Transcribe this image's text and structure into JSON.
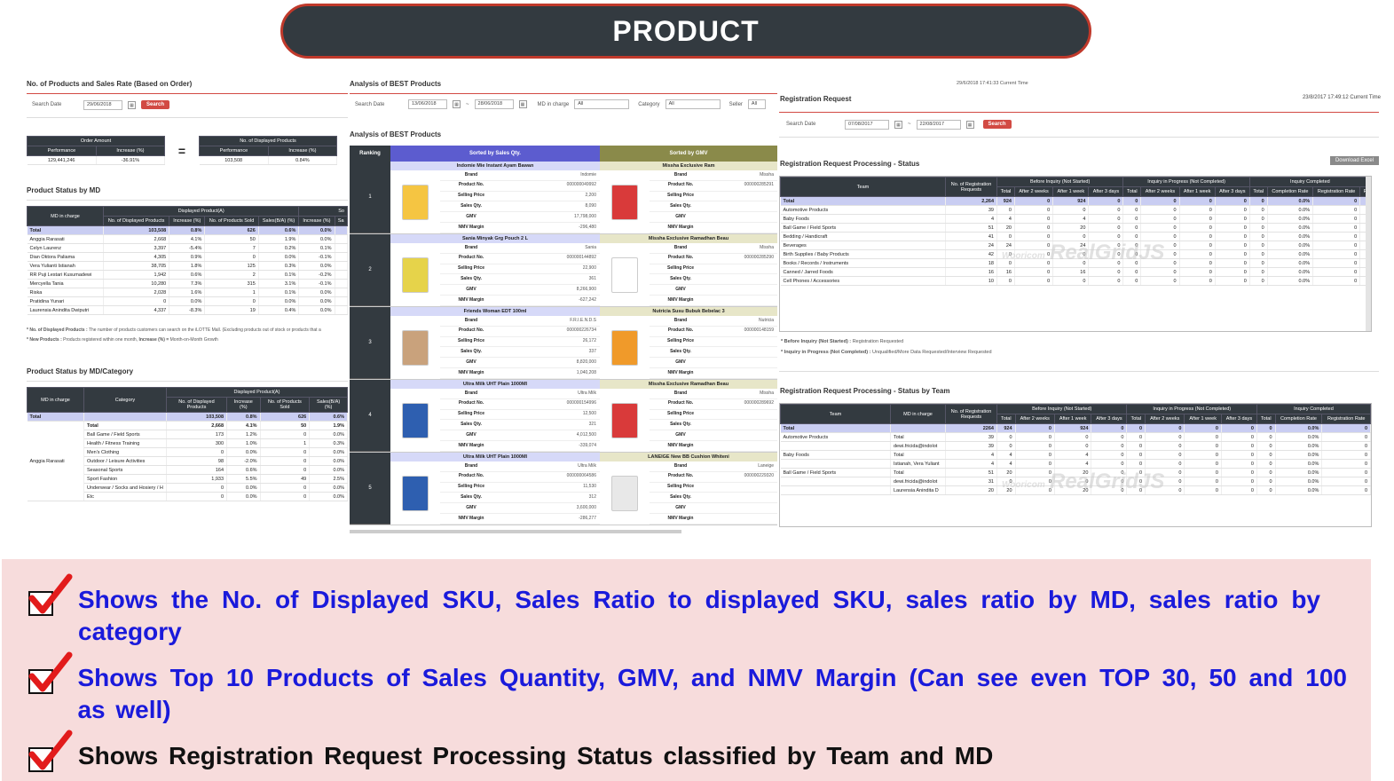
{
  "header": {
    "title": "PRODUCT"
  },
  "panel1": {
    "title": "No. of Products and Sales Rate (Based on Order)",
    "search_label": "Search Date",
    "search_date": "29/06/2018",
    "search_btn": "Search",
    "order_amount": {
      "header": "Order Amount",
      "cols": [
        "Performance",
        "Increase (%)"
      ],
      "values": [
        "129,441,246",
        "-36.91%"
      ]
    },
    "equals": "=",
    "displayed": {
      "header": "No. of Displayed Products",
      "cols": [
        "Performance",
        "Increase (%)"
      ],
      "values": [
        "103,508",
        "0.84%"
      ]
    },
    "md_title": "Product Status by MD",
    "md_group": "Displayed Product(A)",
    "md_group2": "So",
    "md_cols": [
      "MD in charge",
      "No. of Displayed Products",
      "Increase (%)",
      "No. of Products Sold",
      "Sales(B/A) (%)",
      "Increase (%)",
      "Sa"
    ],
    "md_rows": [
      [
        "Total",
        "103,508",
        "0.8%",
        "626",
        "0.6%",
        "0.0%",
        ""
      ],
      [
        "Anggia Rarasati",
        "2,668",
        "4.1%",
        "50",
        "1.9%",
        "0.0%",
        ""
      ],
      [
        "Celyn Laurenz",
        "3,397",
        "-5.4%",
        "7",
        "0.2%",
        "0.1%",
        ""
      ],
      [
        "Dian Oktora Paliama",
        "4,305",
        "0.9%",
        "0",
        "0.0%",
        "-0.1%",
        ""
      ],
      [
        "Vera Yulianti Istianah",
        "38,705",
        "1.8%",
        "125",
        "0.3%",
        "0.0%",
        ""
      ],
      [
        "RR Puji Lestari Kusumadewi",
        "1,942",
        "0.6%",
        "2",
        "0.1%",
        "-0.2%",
        ""
      ],
      [
        "Mercyella Tania",
        "10,280",
        "7.3%",
        "315",
        "3.1%",
        "-0.1%",
        ""
      ],
      [
        "Riska",
        "2,028",
        "1.6%",
        "1",
        "0.1%",
        "0.0%",
        ""
      ],
      [
        "Pratidina Yunari",
        "0",
        "0.0%",
        "0",
        "0.0%",
        "0.0%",
        ""
      ],
      [
        "Laurensia Anindita Dwiputri",
        "4,337",
        "-8.3%",
        "19",
        "0.4%",
        "0.0%",
        ""
      ]
    ],
    "note1_label": "* No. of Displayed Products :",
    "note1_text": "The number of products customers can search on the iLOTTE Mall. (Excluding products out of stock or products that a",
    "note2_label": "* New Products :",
    "note2_text": "Products registered within one month,",
    "note2_label2": "Increase (%) =",
    "note2_text2": "Month-on-Month Growth",
    "cat_title": "Product Status by MD/Category",
    "cat_group": "Displayed Product(A)",
    "cat_cols": [
      "MD in charge",
      "Category",
      "No. of Displayed Products",
      "Increase (%)",
      "No. of Products Sold",
      "Sales(B/A) (%)"
    ],
    "cat_total": [
      "Total",
      "",
      "103,508",
      "0.8%",
      "626",
      "0.6%"
    ],
    "cat_md": "Anggia Rarasati",
    "cat_rows": [
      [
        "Total",
        "2,668",
        "4.1%",
        "50",
        "1.9%"
      ],
      [
        "Ball Game / Field Sports",
        "173",
        "1.2%",
        "0",
        "0.0%"
      ],
      [
        "Health / Fitness Training",
        "300",
        "1.0%",
        "1",
        "0.3%"
      ],
      [
        "Men's Clothing",
        "0",
        "0.0%",
        "0",
        "0.0%"
      ],
      [
        "Outdoor / Leisure Activities",
        "98",
        "-2.0%",
        "0",
        "0.0%"
      ],
      [
        "Seasonal Sports",
        "164",
        "0.6%",
        "0",
        "0.0%"
      ],
      [
        "Sport Fashion",
        "1,933",
        "5.5%",
        "49",
        "2.5%"
      ],
      [
        "Underwear / Socks and Hosiery / H",
        "0",
        "0.0%",
        "0",
        "0.0%"
      ],
      [
        "Etc",
        "0",
        "0.0%",
        "0",
        "0.0%"
      ]
    ]
  },
  "panel2": {
    "title": "Analysis of BEST Products",
    "search_label": "Search Date",
    "date_from": "13/06/2018",
    "date_to": "28/06/2018",
    "md_label": "MD in charge",
    "md_value": "All",
    "cat_label": "Category",
    "cat_value": "All",
    "seller_label": "Seller",
    "seller_value": "All",
    "sub_title": "Analysis of BEST Products",
    "rank_header": "Ranking",
    "qty_header": "Sorted by Sales Qty.",
    "gmv_header": "Sorted by GMV",
    "attr_labels": [
      "Brand",
      "Product No.",
      "Selling Price",
      "Sales Qty.",
      "GMV",
      "NMV Margin"
    ],
    "rows": [
      {
        "rank": "1",
        "q": {
          "name": "Indomie Mie Instant Ayam Bawan",
          "vals": [
            "Indomie",
            "000000049992",
            "2,200",
            "8,090",
            "17,798,000",
            "-296,480"
          ]
        },
        "g": {
          "name": "Missha Exclusive Ram",
          "vals": [
            "Missha",
            "000000285291",
            "",
            "",
            "",
            ""
          ]
        }
      },
      {
        "rank": "2",
        "q": {
          "name": "Sania Minyak Grg Pouch 2 L",
          "vals": [
            "Sania",
            "000000144892",
            "22,900",
            "361",
            "8,266,900",
            "-627,242"
          ]
        },
        "g": {
          "name": "Missha Exclusive Ramadhan Beau",
          "vals": [
            "Missha",
            "000000285290",
            "",
            "",
            "",
            ""
          ]
        }
      },
      {
        "rank": "3",
        "q": {
          "name": "Friends Woman EDT 100ml",
          "vals": [
            "F.R.I.E.N.D.S",
            "000000226734",
            "26,172",
            "337",
            "8,820,000",
            "1,040,208"
          ]
        },
        "g": {
          "name": "Nutricia Susu Bubuk Bebelac 3",
          "vals": [
            "Nutricia",
            "000000148159",
            "",
            "",
            "",
            ""
          ]
        }
      },
      {
        "rank": "4",
        "q": {
          "name": "Ultra Milk UHT Plain 1000Ml",
          "vals": [
            "Ultra Milk",
            "000000154996",
            "12,500",
            "321",
            "4,012,500",
            "-339,074"
          ]
        },
        "g": {
          "name": "Missha Exclusive Ramadhan Beau",
          "vals": [
            "Missha",
            "000000289692",
            "",
            "",
            "",
            ""
          ]
        }
      },
      {
        "rank": "5",
        "q": {
          "name": "Ultra Milk UHT Plain 1000Ml",
          "vals": [
            "Ultra Milk",
            "000000064586",
            "11,530",
            "312",
            "3,600,000",
            "-286,277"
          ]
        },
        "g": {
          "name": "LANEIGE New BB Cushion Whiteni",
          "vals": [
            "Laneige",
            "000000229320",
            "",
            "",
            "",
            ""
          ]
        }
      }
    ]
  },
  "panel3": {
    "top_time": "29/6/2018 17:41:33 Current Time",
    "title": "Registration Request",
    "time": "23/8/2017 17:49:12 Current Time",
    "search_label": "Search Date",
    "date_from": "07/08/2017",
    "date_to": "22/08/2017",
    "search_btn": "Search",
    "status_title": "Registration Request Processing - Status",
    "download_btn": "Download Excel",
    "groups": [
      "Before Inquiry (Not Started)",
      "Inquiry in Progress (Not Completed)",
      "Inquiry Completed"
    ],
    "cols_team": "Team",
    "cols_requests": "No. of Registration Requests",
    "sub_cols": [
      "Total",
      "After 2 weeks",
      "After 1 week",
      "After 3 days",
      "Total",
      "After 2 weeks",
      "After 1 week",
      "After 3 days",
      "Total",
      "Completion Rate",
      "Registration Rate",
      "R"
    ],
    "status_rows": [
      [
        "Total",
        "2,264",
        "924",
        "0",
        "924",
        "0",
        "0",
        "0",
        "0",
        "0",
        "0",
        "0.0%",
        "0",
        ""
      ],
      [
        "Automotive Products",
        "39",
        "0",
        "0",
        "0",
        "0",
        "0",
        "0",
        "0",
        "0",
        "0",
        "0.0%",
        "0",
        ""
      ],
      [
        "Baby Foods",
        "4",
        "4",
        "0",
        "4",
        "0",
        "0",
        "0",
        "0",
        "0",
        "0",
        "0.0%",
        "0",
        ""
      ],
      [
        "Ball Game / Field Sports",
        "51",
        "20",
        "0",
        "20",
        "0",
        "0",
        "0",
        "0",
        "0",
        "0",
        "0.0%",
        "0",
        ""
      ],
      [
        "Bedding / Handicraft",
        "41",
        "0",
        "0",
        "0",
        "0",
        "0",
        "0",
        "0",
        "0",
        "0",
        "0.0%",
        "0",
        ""
      ],
      [
        "Beverages",
        "24",
        "24",
        "0",
        "24",
        "0",
        "0",
        "0",
        "0",
        "0",
        "0",
        "0.0%",
        "0",
        ""
      ],
      [
        "Birth Supplies / Baby Products",
        "42",
        "0",
        "0",
        "0",
        "0",
        "0",
        "0",
        "0",
        "0",
        "0",
        "0.0%",
        "0",
        ""
      ],
      [
        "Books / Records / Instruments",
        "18",
        "0",
        "0",
        "0",
        "0",
        "0",
        "0",
        "0",
        "0",
        "0",
        "0.0%",
        "0",
        ""
      ],
      [
        "Canned / Jarred Foods",
        "16",
        "16",
        "0",
        "16",
        "0",
        "0",
        "0",
        "0",
        "0",
        "0",
        "0.0%",
        "0",
        ""
      ],
      [
        "Cell Phones / Accessories",
        "10",
        "0",
        "0",
        "0",
        "0",
        "0",
        "0",
        "0",
        "0",
        "0",
        "0.0%",
        "0",
        ""
      ]
    ],
    "note1_label": "* Before Inquiry (Not Started) :",
    "note1_text": "Registration Requested",
    "note2_label": "* Inquiry in Progress (Not Completed) :",
    "note2_text": "Unqualified/More Data Requested/Interview Requested",
    "team_title": "Registration Request Processing - Status by Team",
    "team_cols_md": "MD in charge",
    "team_rows": [
      [
        "Total",
        "",
        "2264",
        "924",
        "0",
        "924",
        "0",
        "0",
        "0",
        "0",
        "0",
        "0",
        "0.0%",
        "0"
      ],
      [
        "Automotive Products",
        "Total",
        "39",
        "0",
        "0",
        "0",
        "0",
        "0",
        "0",
        "0",
        "0",
        "0",
        "0.0%",
        "0"
      ],
      [
        "",
        "dewi.fricida@indolot",
        "39",
        "0",
        "0",
        "0",
        "0",
        "0",
        "0",
        "0",
        "0",
        "0",
        "0.0%",
        "0"
      ],
      [
        "Baby Foods",
        "Total",
        "4",
        "4",
        "0",
        "4",
        "0",
        "0",
        "0",
        "0",
        "0",
        "0",
        "0.0%",
        "0"
      ],
      [
        "",
        "Istianah, Vera Yuliant",
        "4",
        "4",
        "0",
        "4",
        "0",
        "0",
        "0",
        "0",
        "0",
        "0",
        "0.0%",
        "0"
      ],
      [
        "Ball Game / Field Sports",
        "Total",
        "51",
        "20",
        "0",
        "20",
        "0",
        "0",
        "0",
        "0",
        "0",
        "0",
        "0.0%",
        "0"
      ],
      [
        "",
        "dewi.fricida@indolot",
        "31",
        "0",
        "0",
        "0",
        "0",
        "0",
        "0",
        "0",
        "0",
        "0",
        "0.0%",
        "0"
      ],
      [
        "",
        "Laurensia Anindita D",
        "20",
        "20",
        "0",
        "20",
        "0",
        "0",
        "0",
        "0",
        "0",
        "0",
        "0.0%",
        "0"
      ]
    ],
    "watermark": "RealGridJS",
    "watermark_small": "Wooricom"
  },
  "bullets": [
    {
      "text": "Shows the No. of Displayed SKU, Sales Ratio to displayed SKU, sales ratio by MD, sales ratio by category",
      "color": "#1a1adb"
    },
    {
      "text": "Shows Top 10 Products of Sales Quantity, GMV, and NMV Margin (Can see even TOP 30, 50 and 100 as well)",
      "color": "#1a1adb"
    },
    {
      "text": "Shows Registration Request Processing Status classified by Team and MD",
      "color": "#111111"
    }
  ],
  "colors": {
    "accent": "#d24a43",
    "header_dark": "#333a40",
    "bullet_bg": "#f7dcdc",
    "highlight_row": "#c9cdf2",
    "qty_header": "#5c5ccf",
    "gmv_header": "#8a8a4a"
  }
}
